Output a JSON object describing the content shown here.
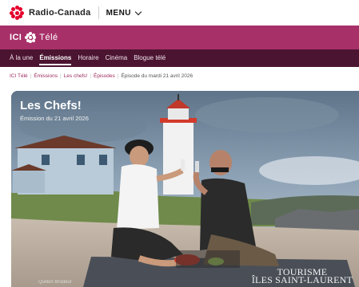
{
  "topbar": {
    "brand": "Radio-Canada",
    "menu_label": "MENU"
  },
  "brandbar": {
    "ici": "ICI",
    "tele": "Télé"
  },
  "nav": {
    "items": [
      {
        "label": "À la une",
        "active": false
      },
      {
        "label": "Émissions",
        "active": true
      },
      {
        "label": "Horaire",
        "active": false
      },
      {
        "label": "Cinéma",
        "active": false
      },
      {
        "label": "Blogue télé",
        "active": false
      }
    ]
  },
  "breadcrumb": {
    "items": [
      "ICI Télé",
      "Émissions",
      "Les chefs!",
      "Épisodes"
    ],
    "current": "Épisode du mardi 21 avril 2026"
  },
  "hero": {
    "title": "Les Chefs!",
    "subtitle": "Émission du 21 avril 2026",
    "watermark_line1": "TOURISME",
    "watermark_line2": "ÎLES SAINT-LAURENT",
    "credit": "Quillon Brodeur"
  },
  "colors": {
    "brand_magenta": "#a83069",
    "nav_dark": "#4b1430",
    "radio_canada_red": "#e4002b"
  }
}
